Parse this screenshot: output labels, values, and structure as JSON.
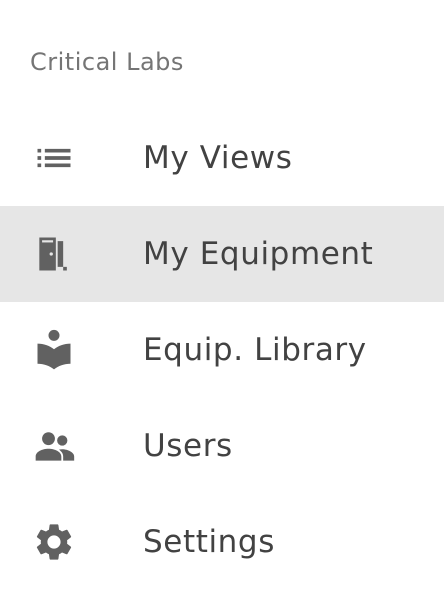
{
  "header": {
    "org_name": "Critical Labs"
  },
  "nav": {
    "items": [
      {
        "label": "My Views",
        "icon": "list-icon",
        "active": false
      },
      {
        "label": "My Equipment",
        "icon": "door-icon",
        "active": true
      },
      {
        "label": "Equip. Library",
        "icon": "book-reader-icon",
        "active": false
      },
      {
        "label": "Users",
        "icon": "people-icon",
        "active": false
      },
      {
        "label": "Settings",
        "icon": "gear-icon",
        "active": false
      }
    ]
  },
  "colors": {
    "icon": "#616161",
    "text": "#424242",
    "header_text": "#757575",
    "active_background": "#e6e6e6"
  }
}
